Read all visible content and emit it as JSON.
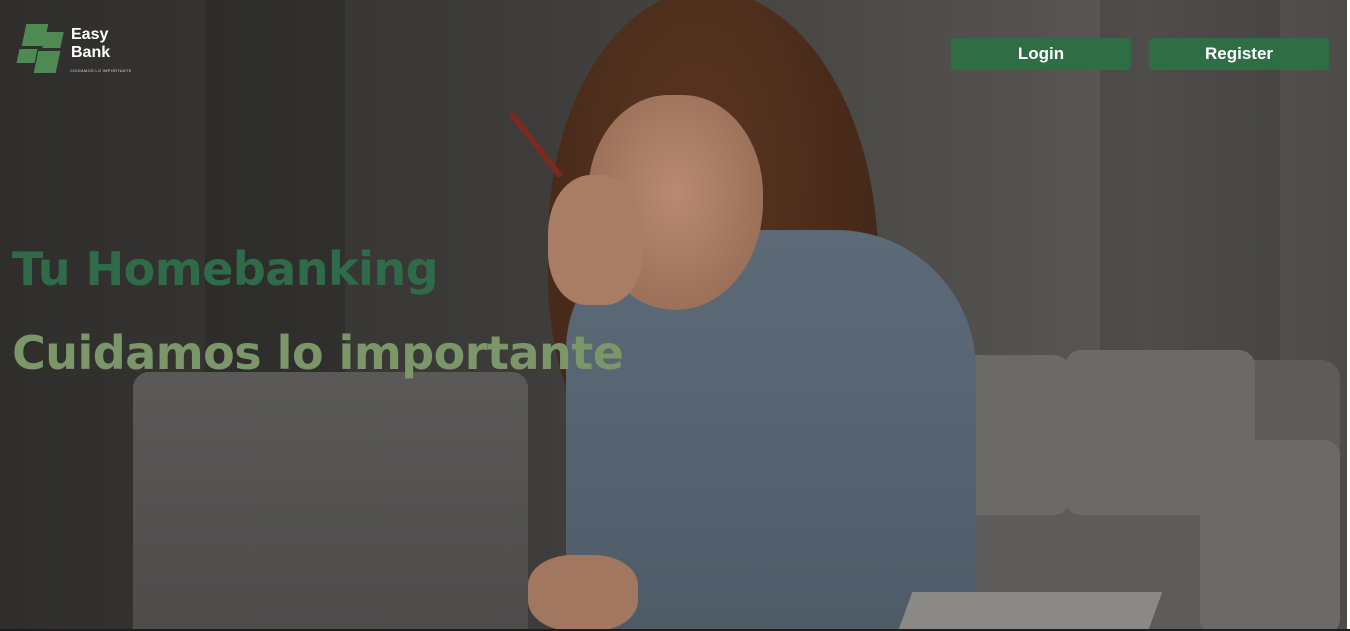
{
  "brand": {
    "name_line1": "Easy",
    "name_line2": "Bank",
    "tagline": "CUIDAMOS LO IMPORTANTE",
    "accent_color": "#4f8a52"
  },
  "header": {
    "login_label": "Login",
    "register_label": "Register",
    "button_color": "#2f6e45"
  },
  "hero": {
    "title": "Tu Homebanking",
    "subtitle": "Cuidamos lo importante",
    "title_color": "#2f6b48",
    "subtitle_color": "#7b9668",
    "background_image": "woman-with-laptop-photo"
  }
}
